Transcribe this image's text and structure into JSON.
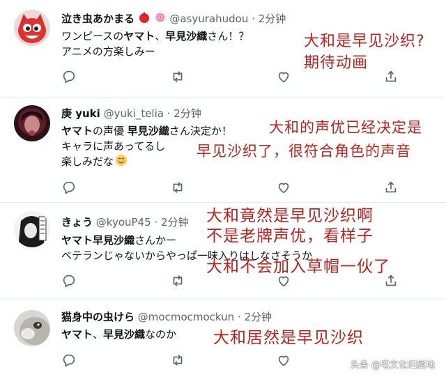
{
  "tweets": [
    {
      "name": "泣き虫あかまる",
      "handle": "@asyurahudou",
      "time": "· 2分钟",
      "lines": [
        [
          "ワンピースの",
          "ヤマト",
          "、",
          "早見沙織",
          "さん！？"
        ],
        [
          "アニメの方楽しみー"
        ]
      ],
      "annotation": [
        "大和是早见沙织?",
        "期待动画"
      ]
    },
    {
      "name": "庚 yuki",
      "handle": "@yuki_telia",
      "time": "· 2分钟",
      "lines": [
        [
          "ヤマト",
          "の声優 ",
          "早見沙織",
          "さん決定か！"
        ],
        [
          "キャラに声あってるし"
        ],
        [
          "楽しみだな"
        ]
      ],
      "annotation": [
        "大和的声优已经决定是",
        "早见沙织了，很符合角色的声音"
      ]
    },
    {
      "name": "きょう",
      "handle": "@kyouP45",
      "time": "· 2分钟",
      "lines": [
        [
          "ヤマト早見沙織",
          "さんかー"
        ],
        [
          "ベテランじゃないからやっぱ一味入りはしなさそうか"
        ]
      ],
      "annotation": [
        "大和竟然是早见沙织啊",
        "不是老牌声优，看样子",
        "大和不会加入草帽一伙了"
      ]
    },
    {
      "name": "猫身中の虫けら",
      "handle": "@mocmocmockun",
      "time": "· 2分钟",
      "lines": [
        [
          "ヤマト",
          "、",
          "早見沙織",
          "なのか"
        ]
      ],
      "annotation": [
        "大和居然是早见沙织"
      ]
    }
  ],
  "icons": [
    "reply-icon",
    "retweet-icon",
    "like-icon",
    "share-icon"
  ],
  "colors": {
    "annotation": "#c0201a",
    "meta": "#536471",
    "action": "#536471",
    "separator": "#e6ecf0"
  },
  "watermark": "头条 @宅文化归属地"
}
